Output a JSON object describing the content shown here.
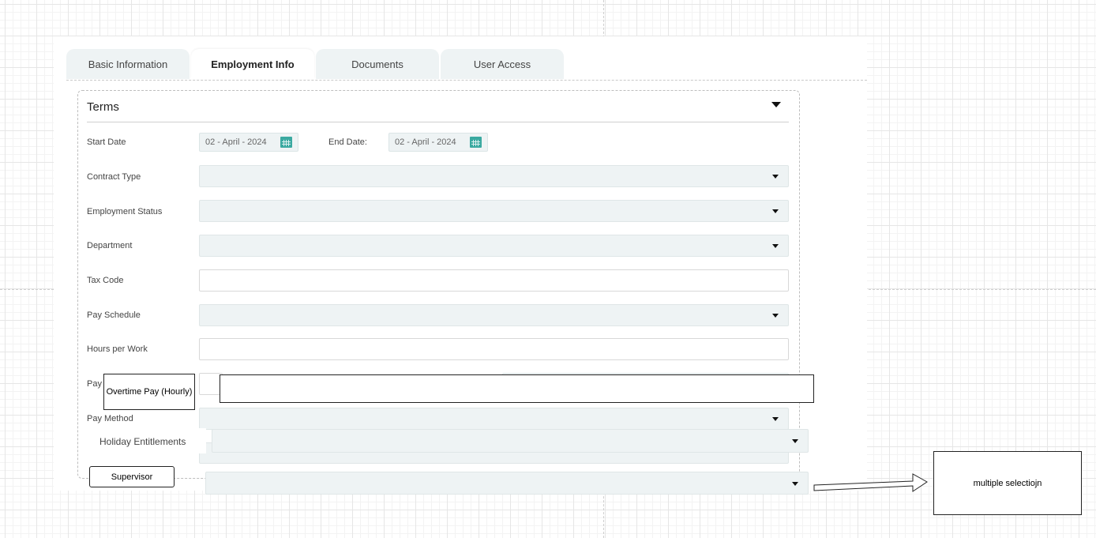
{
  "tabs": [
    {
      "label": "Basic Information"
    },
    {
      "label": "Employment Info"
    },
    {
      "label": "Documents"
    },
    {
      "label": "User Access"
    }
  ],
  "section": {
    "title": "Terms"
  },
  "form": {
    "start_date_label": "Start Date",
    "start_date_value": "02 - April - 2024",
    "end_date_label": "End Date:",
    "end_date_value": "02 - April - 2024",
    "contract_type_label": "Contract Type",
    "employment_status_label": "Employment Status",
    "department_label": "Department",
    "tax_code_label": "Tax Code",
    "pay_schedule_label": "Pay Schedule",
    "hours_per_work_label": "Hours per Work",
    "pay_label_partial": "Pay",
    "pay_method_label": "Pay Method",
    "overtime_label": "Overtime Pay (Hourly)",
    "holiday_label": "Holiday Entitlements",
    "supervisor_label": "Supervisor"
  },
  "annotation": {
    "text": "multiple selectiojn"
  },
  "icons": {
    "calendar": "calendar-icon",
    "dropdown": "chevron-down-icon",
    "arrow": "right-arrow-icon"
  },
  "colors": {
    "field_bg": "#eef3f4",
    "accent": "#3aa9a0"
  }
}
